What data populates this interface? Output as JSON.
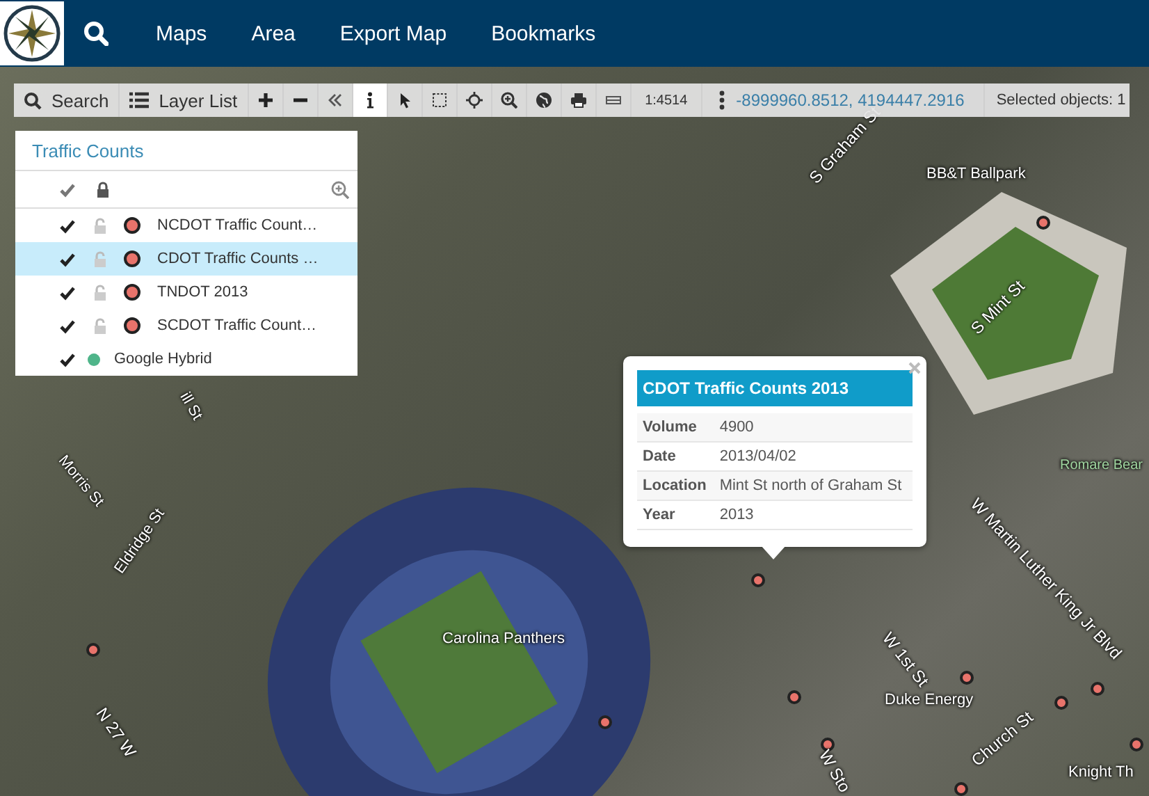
{
  "header": {
    "menu": [
      "Maps",
      "Area",
      "Export Map",
      "Bookmarks"
    ]
  },
  "toolbar": {
    "search_label": "Search",
    "layer_list_label": "Layer List",
    "tools": [
      {
        "kind": "zoom-in",
        "selected": false
      },
      {
        "kind": "zoom-out",
        "selected": false
      },
      {
        "kind": "collapse",
        "selected": false
      },
      {
        "kind": "info",
        "selected": true
      },
      {
        "kind": "pointer",
        "selected": false
      },
      {
        "kind": "box-select",
        "selected": false
      },
      {
        "kind": "pan",
        "selected": false
      },
      {
        "kind": "zoom-box",
        "selected": false
      },
      {
        "kind": "globe",
        "selected": false
      },
      {
        "kind": "print",
        "selected": false
      },
      {
        "kind": "measure",
        "selected": false
      }
    ],
    "scale": "1:4514",
    "coordinates": "-8999960.8512, 4194447.2916",
    "selected_objects": "Selected objects: 1"
  },
  "layer_panel": {
    "title": "Traffic Counts",
    "layers": [
      {
        "kind": "layer",
        "name": "NCDOT Traffic Count…",
        "visible": true,
        "locked": false,
        "selected": false,
        "color": "#e8736b"
      },
      {
        "kind": "layer",
        "name": "CDOT Traffic Counts …",
        "visible": true,
        "locked": false,
        "selected": true,
        "color": "#e8736b"
      },
      {
        "kind": "layer",
        "name": "TNDOT 2013",
        "visible": true,
        "locked": false,
        "selected": false,
        "color": "#e8736b"
      },
      {
        "kind": "layer",
        "name": "SCDOT Traffic Count…",
        "visible": true,
        "locked": false,
        "selected": false,
        "color": "#e8736b"
      },
      {
        "kind": "basemap",
        "name": "Google Hybrid",
        "visible": true,
        "selected": false,
        "color": "#4fb58a"
      }
    ]
  },
  "popup": {
    "title": "CDOT Traffic Counts 2013",
    "rows": [
      {
        "label": "Volume",
        "value": "4900"
      },
      {
        "label": "Date",
        "value": "2013/04/02"
      },
      {
        "label": "Location",
        "value": "Mint St north of Graham St"
      },
      {
        "label": "Year",
        "value": "2013"
      }
    ]
  },
  "map": {
    "labels": [
      "S Graham St",
      "BB&T Ballpark",
      "S Mint St",
      "W Martin Luther King Jr Blvd",
      "Romare Bear",
      "Carolina Panthers",
      "Duke Energy",
      "W 1st St",
      "Church St",
      "Knight Th",
      "N 27 W",
      "Eldridge St",
      "Morris St",
      "ill St",
      "W Sto"
    ]
  }
}
